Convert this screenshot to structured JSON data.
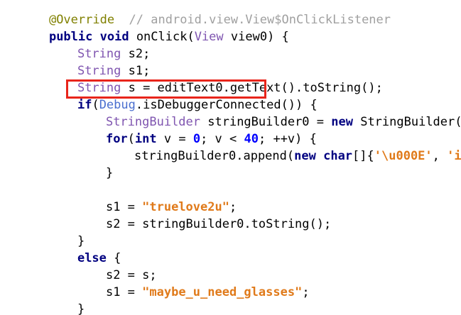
{
  "code": {
    "line0": {
      "annotation": "@Override",
      "comment": "  // android.view.View$OnClickListener"
    },
    "line1": {
      "kw1": "public",
      "sp1": " ",
      "kw2": "void",
      "rest1": " onClick(",
      "type": "View",
      "rest2": " view0) {"
    },
    "line2": {
      "type": "String",
      "rest": " s2;"
    },
    "line3": {
      "type": "String",
      "rest": " s1;"
    },
    "line4": {
      "type": "String",
      "rest": " s = editText0.getText().toString();"
    },
    "line5": {
      "kw": "if",
      "paren": "(",
      "cls": "Debug",
      "call": ".isDebuggerConnected()",
      "rest": ") {"
    },
    "line6": {
      "type": "StringBuilder",
      "rest1": " stringBuilder0 = ",
      "kw": "new",
      "rest2": " StringBuilder();"
    },
    "line7": {
      "kw1": "for",
      "p1": "(",
      "kw2": "int",
      "r1": " v = ",
      "n1": "0",
      "r2": "; v < ",
      "n2": "40",
      "r3": "; ++v) {"
    },
    "line8": {
      "r1": "stringBuilder0.append(",
      "kw1": "new",
      "sp": " ",
      "kw2": "char",
      "r2": "[]{",
      "s1": "'\\u000E'",
      "r3": ", ",
      "s2": "'i'",
      "r4": ", ",
      "s3": "'="
    },
    "line9": {
      "text": "}"
    },
    "line11": {
      "r1": "s1 = ",
      "str": "\"truelove2u\"",
      "r2": ";"
    },
    "line12": {
      "text": "s2 = stringBuilder0.toString();"
    },
    "line13": {
      "text": "}"
    },
    "line14": {
      "kw": "else",
      "rest": " {"
    },
    "line15": {
      "text": "s2 = s;"
    },
    "line16": {
      "r1": "s1 = ",
      "str": "\"maybe_u_need_glasses\"",
      "r2": ";"
    },
    "line17": {
      "text": "}"
    }
  },
  "highlight": {
    "color": "#e8251b",
    "target": "Debug.isDebuggerConnected()"
  },
  "colors": {
    "keyword": "#000080",
    "type": "#7f55b0",
    "string": "#e07a1a",
    "number": "#0000ff",
    "comment": "#a0a0a0",
    "annotation": "#808000"
  }
}
